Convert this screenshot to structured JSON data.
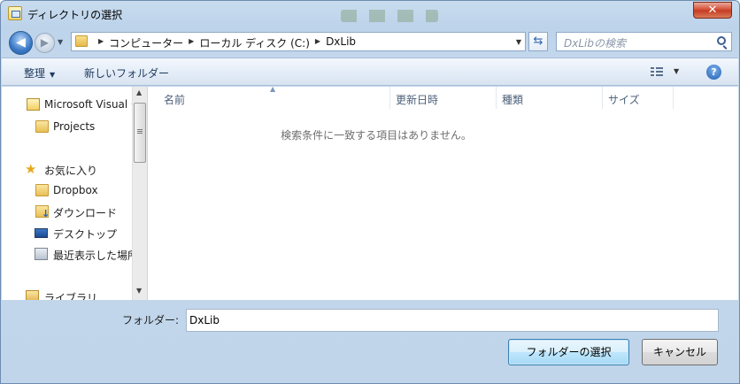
{
  "window": {
    "title": "ディレクトリの選択",
    "close_label": "✕"
  },
  "nav": {
    "back_label": "◀",
    "forward_label": "▶",
    "breadcrumb": [
      "コンピューター",
      "ローカル ディスク (C:)",
      "DxLib"
    ],
    "search_placeholder": "DxLibの検索"
  },
  "toolbar": {
    "organize_label": "整理",
    "new_folder_label": "新しいフォルダー",
    "help_label": "?"
  },
  "nav_pane": {
    "items": [
      {
        "label": "Microsoft Visual C",
        "icon": "visual-studio-icon"
      },
      {
        "label": "Projects",
        "icon": "folder-icon"
      },
      {
        "label": "お気に入り",
        "icon": "star-icon"
      },
      {
        "label": "Dropbox",
        "icon": "folder-icon"
      },
      {
        "label": "ダウンロード",
        "icon": "downloads-icon"
      },
      {
        "label": "デスクトップ",
        "icon": "desktop-icon"
      },
      {
        "label": "最近表示した場所",
        "icon": "recent-places-icon"
      },
      {
        "label": "ライブラリ",
        "icon": "library-icon"
      }
    ]
  },
  "content": {
    "columns": [
      "名前",
      "更新日時",
      "種類",
      "サイズ"
    ],
    "empty_message": "検索条件に一致する項目はありません。"
  },
  "footer": {
    "folder_label": "フォルダー:",
    "folder_value": "DxLib",
    "select_button": "フォルダーの選択",
    "cancel_button": "キャンセル"
  }
}
